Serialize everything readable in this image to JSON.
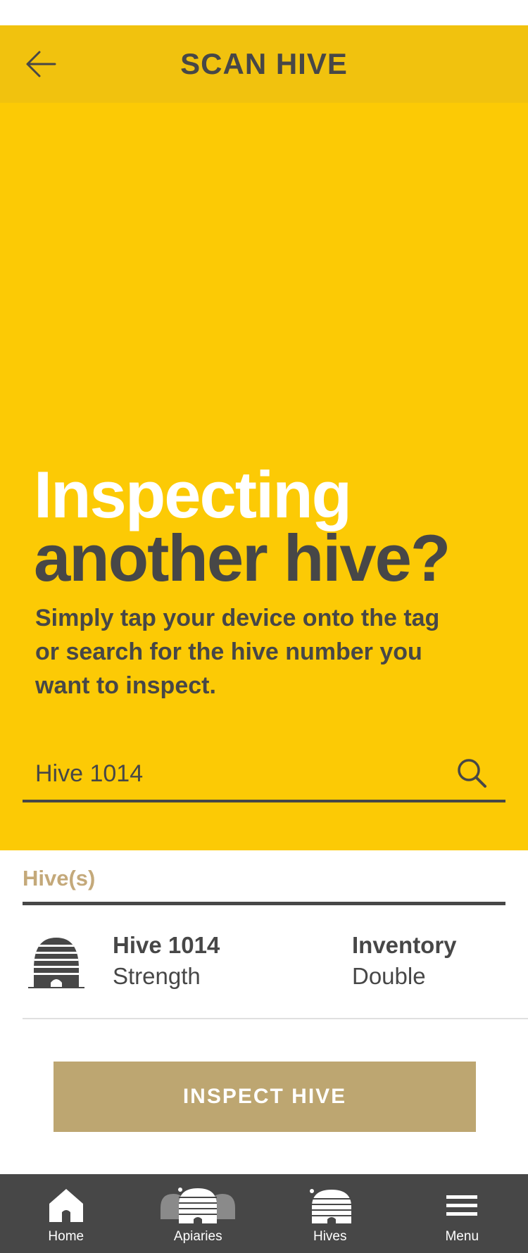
{
  "header": {
    "title": "SCAN HIVE",
    "back_icon": "arrow-left-icon",
    "background": "#f1c20e"
  },
  "hero": {
    "title_line1": "Inspecting",
    "title_line2": "another hive?",
    "subtitle": "Simply tap your device onto the tag or search for the hive number you want to inspect.",
    "background": "#fcca05"
  },
  "search": {
    "value": "Hive 1014",
    "placeholder": "",
    "icon": "search-icon"
  },
  "results": {
    "section_label": "Hive(s)",
    "items": [
      {
        "name": "Hive 1014",
        "strength": "Strength",
        "inventory_label": "Inventory",
        "inventory_value": "Double",
        "icon": "beehive-icon"
      }
    ]
  },
  "actions": {
    "inspect_label": "INSPECT HIVE"
  },
  "nav": {
    "items": [
      {
        "label": "Home",
        "icon": "home-icon"
      },
      {
        "label": "Apiaries",
        "icon": "apiaries-icon"
      },
      {
        "label": "Hives",
        "icon": "hives-icon"
      },
      {
        "label": "Menu",
        "icon": "menu-icon"
      }
    ]
  },
  "colors": {
    "yellow": "#fcca05",
    "header_yellow": "#f1c20e",
    "dark": "#474747",
    "gold": "#bda671",
    "label_gold": "#c4a97a"
  }
}
